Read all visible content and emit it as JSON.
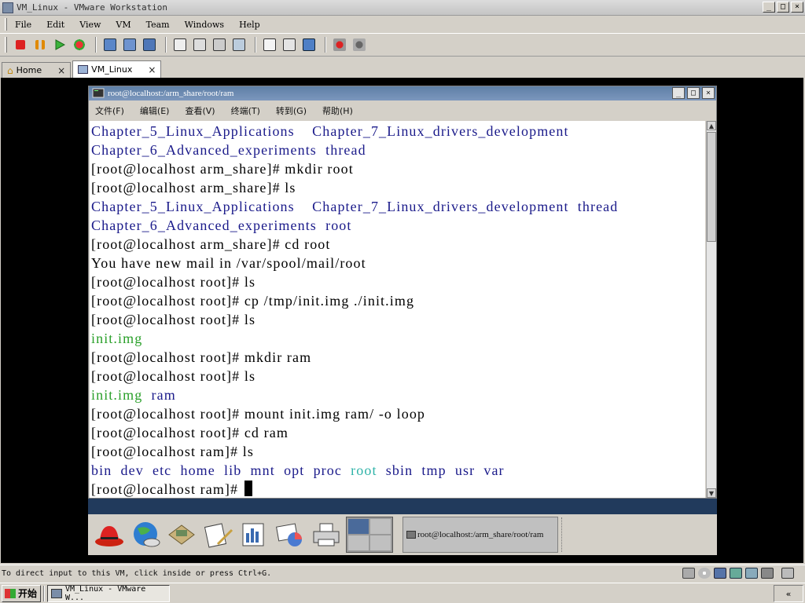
{
  "window": {
    "title": "VM_Linux - VMware Workstation",
    "min": "_",
    "max": "□",
    "close": "×"
  },
  "menubar": {
    "items": [
      "File",
      "Edit",
      "View",
      "VM",
      "Team",
      "Windows",
      "Help"
    ]
  },
  "tabs": [
    {
      "label": "Home",
      "close": "×"
    },
    {
      "label": "VM_Linux",
      "close": "×"
    }
  ],
  "terminal": {
    "title": "root@localhost:/arm_share/root/ram",
    "menu": [
      "文件(F)",
      "编辑(E)",
      "查看(V)",
      "终端(T)",
      "转到(G)",
      "帮助(H)"
    ],
    "lines": [
      {
        "text": "Chapter_5_Linux_Applications    Chapter_7_Linux_drivers_development",
        "color": "blue"
      },
      {
        "text": "Chapter_6_Advanced_experiments  thread",
        "color": "blue"
      },
      {
        "text": "[root@localhost arm_share]# mkdir root",
        "color": "black"
      },
      {
        "text": "[root@localhost arm_share]# ls",
        "color": "black"
      },
      {
        "text": "Chapter_5_Linux_Applications    Chapter_7_Linux_drivers_development  thread",
        "color": "blue"
      },
      {
        "text": "Chapter_6_Advanced_experiments  root",
        "color": "blue"
      },
      {
        "text": "[root@localhost arm_share]# cd root",
        "color": "black"
      },
      {
        "text": "You have new mail in /var/spool/mail/root",
        "color": "black"
      },
      {
        "text": "[root@localhost root]# ls",
        "color": "black"
      },
      {
        "text": "[root@localhost root]# cp /tmp/init.img ./init.img",
        "color": "black"
      },
      {
        "text": "[root@localhost root]# ls",
        "color": "black"
      },
      {
        "text": "init.img",
        "color": "green"
      },
      {
        "text": "[root@localhost root]# mkdir ram",
        "color": "black"
      },
      {
        "text": "[root@localhost root]# ls",
        "color": "black"
      },
      {
        "text": "init.img  ram",
        "color": "mixed-initram"
      },
      {
        "text": "[root@localhost root]# mount init.img ram/ -o loop",
        "color": "black"
      },
      {
        "text": "[root@localhost root]# cd ram",
        "color": "black"
      },
      {
        "text": "[root@localhost ram]# ls",
        "color": "black"
      },
      {
        "text": "bin  dev  etc  home  lib  mnt  opt  proc  root  sbin  tmp  usr  var",
        "color": "mixed-dirs"
      },
      {
        "text": "[root@localhost ram]# ",
        "color": "black",
        "cursor": true
      }
    ],
    "line_ram_parts": [
      "init.img",
      "  ",
      "ram"
    ],
    "line_dirs_parts": {
      "before": "bin  dev  etc  home  lib  mnt  opt  proc  ",
      "highlight": "root",
      "after": "  sbin  tmp  usr  var"
    }
  },
  "guest_panel": {
    "task_title": "root@localhost:/arm_share/root/ram"
  },
  "statusbar": {
    "message": "To direct input to this VM, click inside or press Ctrl+G."
  },
  "taskbar": {
    "start_label": "开始",
    "task_label": "VM_Linux - VMware W...",
    "tray": "«"
  },
  "colors": {
    "blue": "#1a1a8a",
    "green": "#2aa02a",
    "cyan": "#2fb3a8",
    "title_gradient": "#5e7fa6"
  }
}
